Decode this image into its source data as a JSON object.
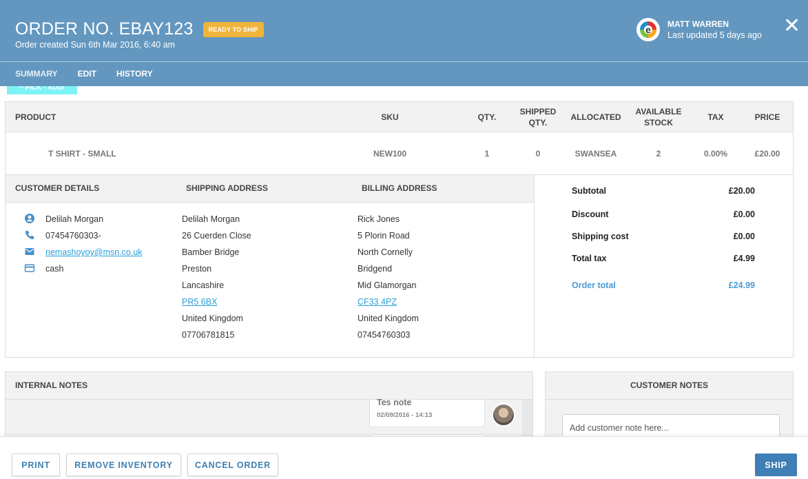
{
  "header": {
    "title": "ORDER NO. EBAY123",
    "status_badge": "READY TO SHIP",
    "created": "Order created Sun 6th Mar 2016, 6:40 am",
    "user_name": "MATT WARREN",
    "last_updated": "Last updated 5 days ago",
    "logo_letter": "e",
    "close_glyph": "✕",
    "tabs": [
      {
        "label": "SUMMARY",
        "active": true
      },
      {
        "label": "EDIT",
        "active": false
      },
      {
        "label": "HISTORY",
        "active": false
      }
    ],
    "tag_strip_text": "^ PICK - ADD!",
    "colors": {
      "header_bg": "#6397bf",
      "badge_bg": "#f0b43a",
      "accent_blue": "#3f7fb5",
      "link": "#2a9fd6"
    }
  },
  "products": {
    "columns": [
      "PRODUCT",
      "SKU",
      "QTY.",
      "SHIPPED QTY.",
      "ALLOCATED",
      "AVAILABLE STOCK",
      "TAX",
      "PRICE"
    ],
    "column_lines": {
      "shipped": [
        "SHIPPED",
        "QTY."
      ],
      "available": [
        "AVAILABLE",
        "STOCK"
      ]
    },
    "rows": [
      {
        "product": "T SHIRT - SMALL",
        "sku": "NEW100",
        "qty": "1",
        "shipped_qty": "0",
        "allocated": "SWANSEA",
        "available_stock": "2",
        "tax": "0.00%",
        "price": "£20.00"
      }
    ]
  },
  "customer": {
    "heading": "CUSTOMER DETAILS",
    "name": "Delilah Morgan",
    "phone": "07454760303-",
    "email": "nemashoyoy@msn.co.uk",
    "payment": "cash",
    "icons": [
      "person-icon",
      "phone-icon",
      "email-icon",
      "credit-card-icon"
    ]
  },
  "shipping": {
    "heading": "SHIPPING ADDRESS",
    "lines": [
      "Delilah Morgan",
      "26 Cuerden Close",
      "Bamber Bridge",
      "Preston",
      "Lancashire",
      "PR5 6BX",
      "United Kingdom",
      "07706781815"
    ]
  },
  "billing": {
    "heading": "BILLING ADDRESS",
    "lines": [
      "Rick Jones",
      "5 Plorin Road",
      "North Cornelly",
      "Bridgend",
      "Mid Glamorgan",
      "CF33 4PZ",
      "United Kingdom",
      "07454760303"
    ]
  },
  "summary": {
    "subtotal_label": "Subtotal",
    "subtotal": "£20.00",
    "discount_label": "Discount",
    "discount": "£0.00",
    "shipping_label": "Shipping cost",
    "shipping": "£0.00",
    "tax_label": "Total tax",
    "tax": "£4.99",
    "total_label": "Order total",
    "total": "£24.99"
  },
  "internal_notes": {
    "heading": "INTERNAL NOTES",
    "notes": [
      {
        "text": "Tes note",
        "date": "02/09/2016 - 14:13"
      }
    ]
  },
  "customer_notes": {
    "heading": "CUSTOMER NOTES",
    "placeholder": "Add customer note here..."
  },
  "footer": {
    "print": "PRINT",
    "remove_inventory": "REMOVE INVENTORY",
    "cancel_order": "CANCEL ORDER",
    "ship": "SHIP"
  }
}
